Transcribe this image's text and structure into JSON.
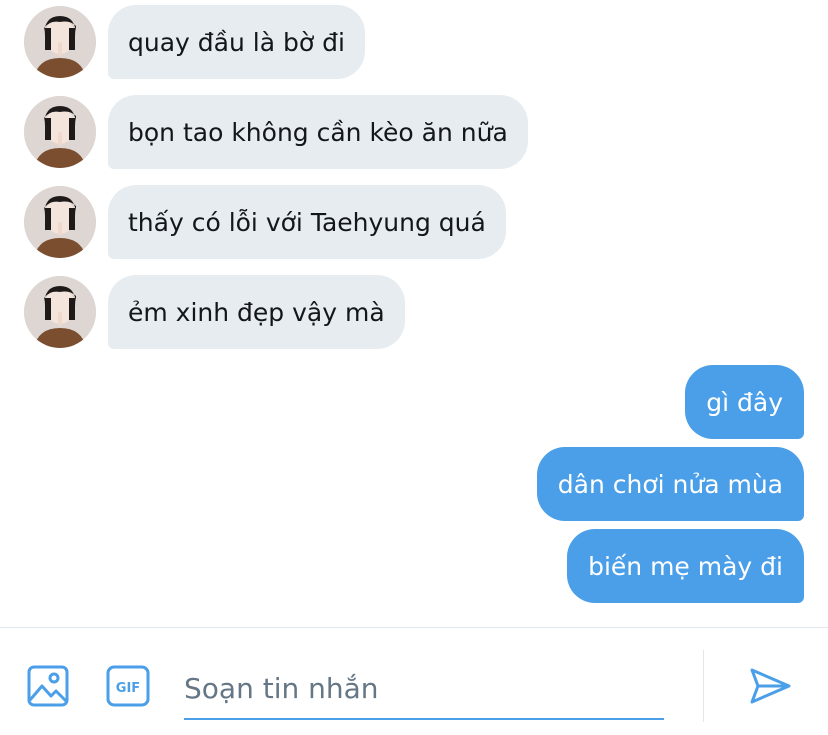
{
  "incoming_messages": [
    {
      "text": "quay đầu là bờ đi"
    },
    {
      "text": "bọn tao không cần kèo ăn nữa"
    },
    {
      "text": "thấy có lỗi với Taehyung quá"
    },
    {
      "text": "ẻm xinh đẹp vậy mà"
    }
  ],
  "outgoing_messages": [
    {
      "text": "gì đây"
    },
    {
      "text": "dân chơi nửa mùa"
    },
    {
      "text": "biến mẹ mày đi"
    }
  ],
  "composer": {
    "placeholder": "Soạn tin nhắn",
    "image_icon": "image-icon",
    "gif_icon": "gif-icon",
    "gif_label": "GIF",
    "send_icon": "send-icon"
  },
  "colors": {
    "accent": "#4a9fe8",
    "incoming_bubble": "#e6ecf0",
    "incoming_text": "#14171a",
    "outgoing_text": "#ffffff",
    "placeholder": "#657786"
  }
}
